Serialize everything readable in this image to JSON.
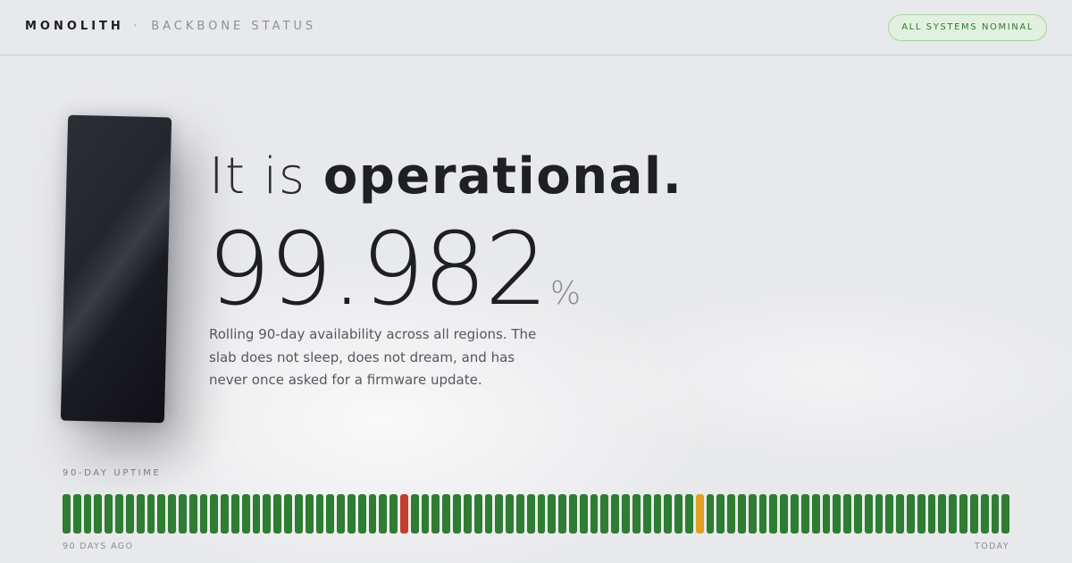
{
  "header": {
    "brand_name": "MONOLITH",
    "separator": "·",
    "brand_subtitle": "BACKBONE STATUS",
    "status_pill": "ALL SYSTEMS NOMINAL"
  },
  "hero": {
    "headline_prefix": "It is",
    "headline_emphasis": "operational.",
    "availability_value": "99.982",
    "availability_unit": "%",
    "description": "Rolling 90-day availability across all regions. The slab does not sleep, does not dream, and has never once asked for a firmware update."
  },
  "uptime": {
    "label": "90-DAY UPTIME",
    "start_label": "90 DAYS AGO",
    "end_label": "TODAY",
    "colors": {
      "operational": "#2e7d32",
      "outage": "#c43e2e",
      "degraded": "#e0a020"
    },
    "days": [
      "operational",
      "operational",
      "operational",
      "operational",
      "operational",
      "operational",
      "operational",
      "operational",
      "operational",
      "operational",
      "operational",
      "operational",
      "operational",
      "operational",
      "operational",
      "operational",
      "operational",
      "operational",
      "operational",
      "operational",
      "operational",
      "operational",
      "operational",
      "operational",
      "operational",
      "operational",
      "operational",
      "operational",
      "operational",
      "operational",
      "operational",
      "operational",
      "outage",
      "operational",
      "operational",
      "operational",
      "operational",
      "operational",
      "operational",
      "operational",
      "operational",
      "operational",
      "operational",
      "operational",
      "operational",
      "operational",
      "operational",
      "operational",
      "operational",
      "operational",
      "operational",
      "operational",
      "operational",
      "operational",
      "operational",
      "operational",
      "operational",
      "operational",
      "operational",
      "operational",
      "degraded",
      "operational",
      "operational",
      "operational",
      "operational",
      "operational",
      "operational",
      "operational",
      "operational",
      "operational",
      "operational",
      "operational",
      "operational",
      "operational",
      "operational",
      "operational",
      "operational",
      "operational",
      "operational",
      "operational",
      "operational",
      "operational",
      "operational",
      "operational",
      "operational",
      "operational",
      "operational",
      "operational",
      "operational",
      "operational"
    ]
  }
}
